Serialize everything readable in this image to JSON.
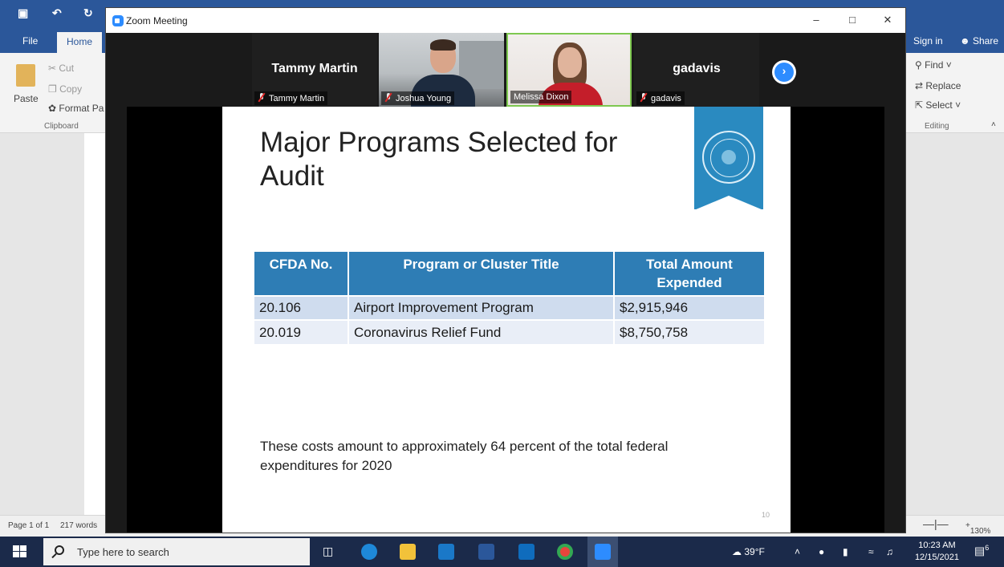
{
  "word": {
    "tabs": [
      "File",
      "Home"
    ],
    "signin": "Sign in",
    "share": "Share",
    "clipboard": {
      "paste": "Paste",
      "cut": "Cut",
      "copy": "Copy",
      "format_painter": "Format Pa",
      "group_label": "Clipboard"
    },
    "editing": {
      "find": "Find",
      "replace": "Replace",
      "select": "Select",
      "group_label": "Editing"
    },
    "status": {
      "page": "Page 1 of 1",
      "words": "217 words",
      "zoom": "130%"
    }
  },
  "zoom": {
    "window_title": "Zoom Meeting",
    "participants": [
      {
        "display_name": "Tammy Martin",
        "label": "Tammy Martin",
        "muted": true,
        "video": false
      },
      {
        "display_name": "",
        "label": "Joshua Young",
        "muted": true,
        "video": true
      },
      {
        "display_name": "",
        "label": "Melissa Dixon",
        "muted": false,
        "video": true,
        "active_speaker": true
      },
      {
        "display_name": "gadavis",
        "label": "gadavis",
        "muted": true,
        "video": false
      }
    ],
    "next_icon": "chevron-right-icon",
    "slide": {
      "title": "Major Programs Selected for Audit",
      "table": {
        "headers": [
          "CFDA No.",
          "Program or Cluster Title",
          "Total Amount Expended"
        ],
        "rows": [
          [
            "20.106",
            "Airport Improvement Program",
            "$2,915,946"
          ],
          [
            "20.019",
            "Coronavirus Relief Fund",
            "$8,750,758"
          ]
        ]
      },
      "footnote": "These costs amount to approximately 64 percent of the total federal expenditures for 2020",
      "page_number": "10"
    }
  },
  "taskbar": {
    "search_placeholder": "Type here to search",
    "weather": "39°F",
    "time": "10:23 AM",
    "date": "12/15/2021",
    "notification_count": "6"
  },
  "colors": {
    "zoom_blue": "#2d8cff",
    "word_blue": "#2b579a",
    "table_header": "#2e7db5",
    "active_speaker": "#7ec850"
  }
}
